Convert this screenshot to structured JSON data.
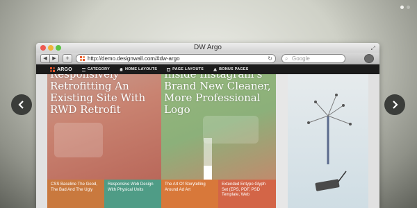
{
  "slider": {
    "dots": 2,
    "active_dot": 0
  },
  "window": {
    "title": "DW Argo"
  },
  "toolbar": {
    "back": "◀",
    "forward": "▶",
    "plus": "+",
    "url": "http://demo.designwall.com/#dw-argo",
    "reload": "↻",
    "search_placeholder": "Google"
  },
  "site_nav": {
    "logo": "ARGO",
    "items": [
      "CATEGORY",
      "HOME LAYOUTS",
      "PAGE LAYOUTS",
      "BONUS PAGES"
    ]
  },
  "posts": [
    {
      "title": "Responsively Retrofitting An Existing Site With RWD Retrofit"
    },
    {
      "title": "Inside Instagram's Brand New Cleaner, More Professional Logo"
    }
  ],
  "subposts": [
    "CSS Baseline The Good, The Bad And The Ugly",
    "Responsive Web Design With Physical Units",
    "The Art Of Storytelling Around Ad Art",
    "Extended Entypo Glyph Set (EPS, PDF, PSD Template, Web"
  ],
  "colors": {
    "accent": "#e8572d",
    "nav_bg": "#1b1b1b"
  }
}
